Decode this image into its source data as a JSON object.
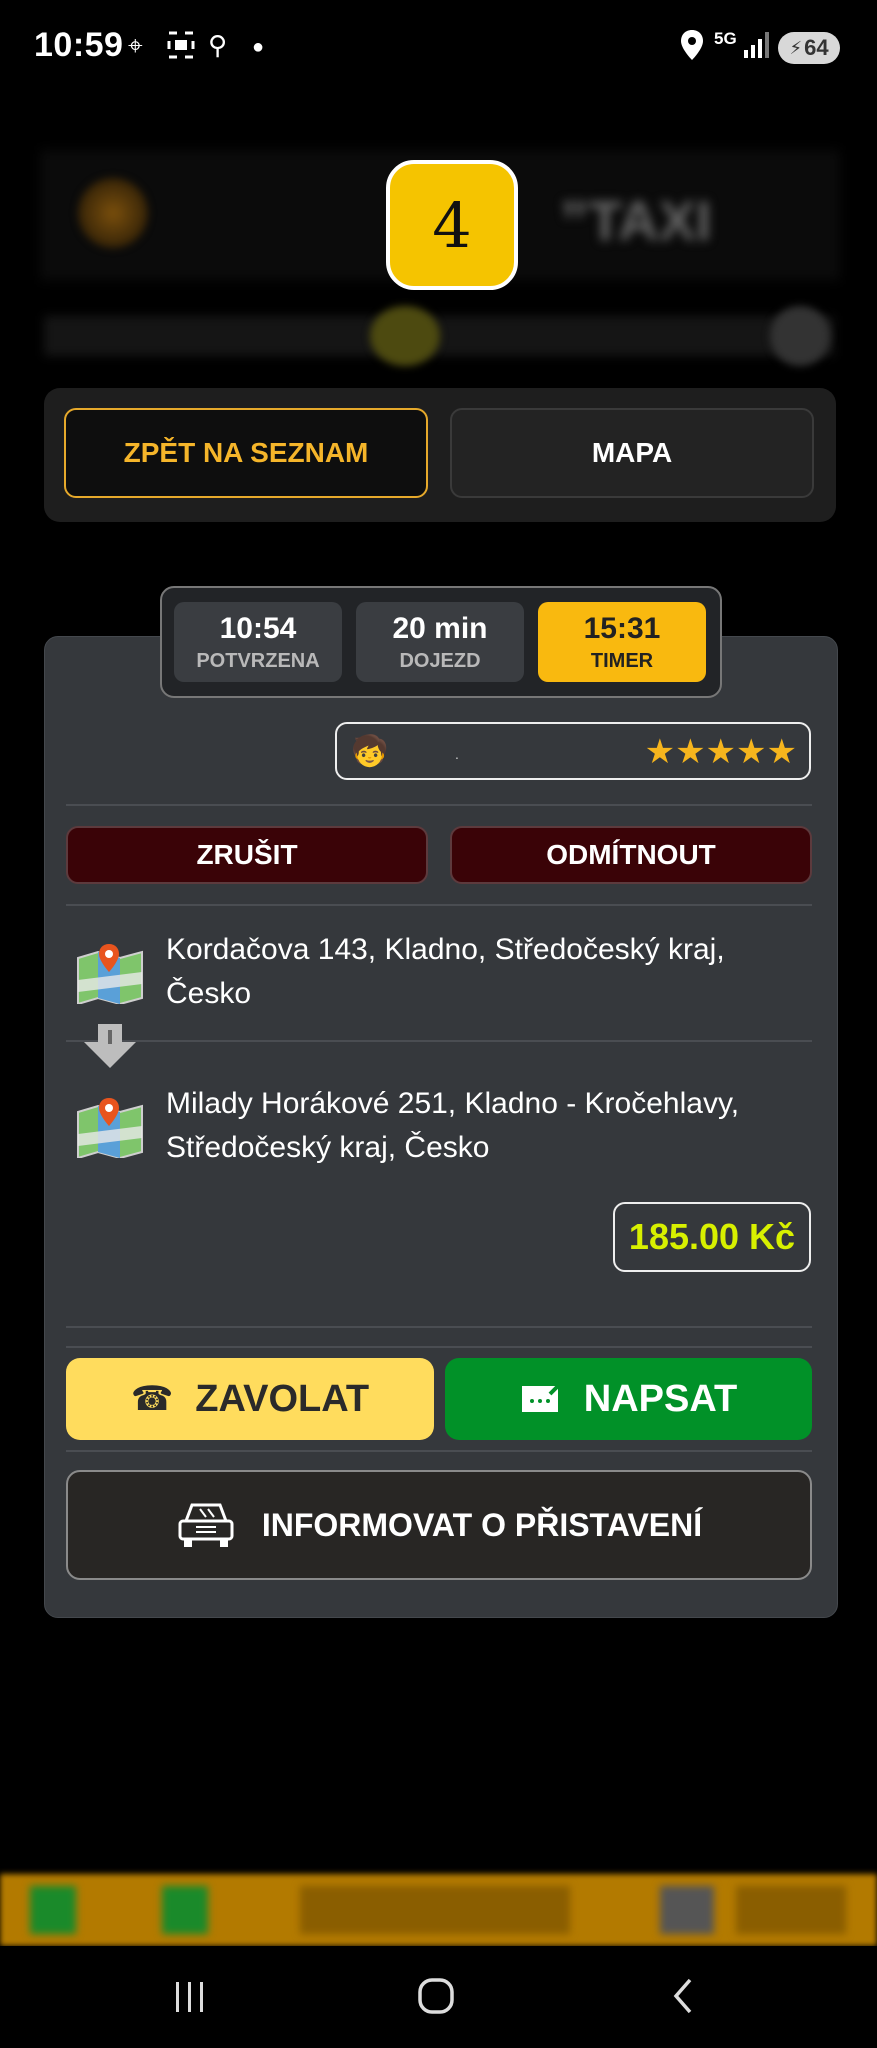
{
  "status_bar": {
    "time": "10:59",
    "network": "5G",
    "battery": "64",
    "icons": [
      "location-target-icon",
      "screenshot-icon",
      "usb-icon",
      "dot-icon",
      "location-pin-icon",
      "signal-icon",
      "battery-icon"
    ]
  },
  "header": {
    "badge_number": "4"
  },
  "nav": {
    "back_label": "ZPĚT NA SEZNAM",
    "map_label": "MAPA"
  },
  "timers": [
    {
      "value": "10:54",
      "label": "POTVRZENA"
    },
    {
      "value": "20 min",
      "label": "DOJEZD"
    },
    {
      "value": "15:31",
      "label": "TIMER"
    }
  ],
  "customer": {
    "rating_stars": 5,
    "stars_text": "★★★★★"
  },
  "actions": {
    "cancel_label": "ZRUŠIT",
    "reject_label": "ODMÍTNOUT"
  },
  "route": {
    "pickup_line1": "Kordačova 143, Kladno, Středočeský kraj,",
    "pickup_line2": "Česko",
    "dropoff_line1": "Milady Horákové 251, Kladno - Kročehlavy,",
    "dropoff_line2": "Středočeský kraj, Česko"
  },
  "price": "185.00 Kč",
  "contact": {
    "call_label": "ZAVOLAT",
    "write_label": "NAPSAT"
  },
  "inform_label": "INFORMOVAT O PŘISTAVENÍ",
  "colors": {
    "accent_yellow": "#f9b90f",
    "call_yellow": "#ffdc5d",
    "write_green": "#019128",
    "price_green": "#d8f000",
    "danger_dark_red": "#3a0307"
  }
}
